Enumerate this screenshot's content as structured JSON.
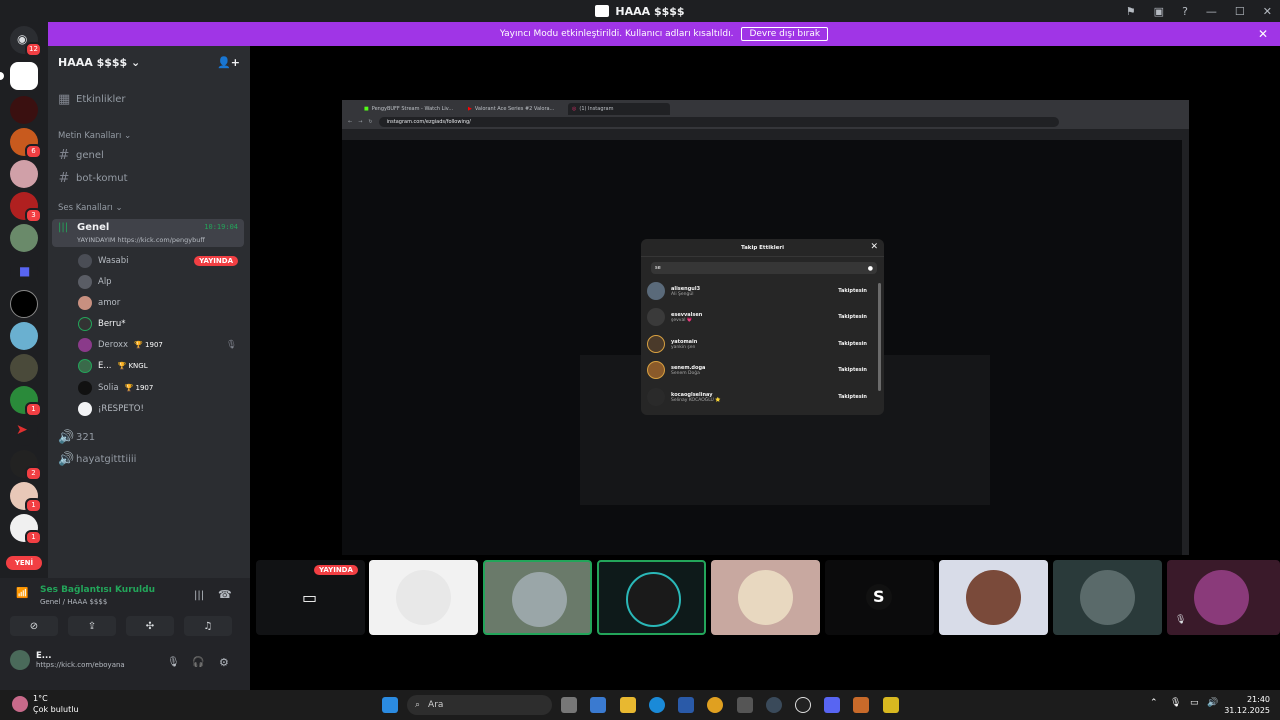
{
  "window": {
    "title": "HAAA $$$$"
  },
  "banner": {
    "text": "Yayıncı Modu etkinleştirildi. Kullanıcı adları kısaltıldı.",
    "button": "Devre dışı bırak"
  },
  "guild_badges": [
    "12",
    "6",
    "3",
    "1",
    "2",
    "1",
    "1",
    "1",
    "YENİ"
  ],
  "server": {
    "name": "HAAA $$$$",
    "events": "Etkinlikler",
    "text_category": "Metin Kanalları",
    "text_channels": [
      "genel",
      "bot-komut"
    ],
    "voice_category": "Ses Kanalları",
    "active_voice": {
      "name": "Genel",
      "timer": "10:19:04",
      "status": "YAYINDAYIM https://kick.com/pengybuff"
    },
    "voice_users": [
      {
        "name": "Wasabi",
        "tag": "",
        "live": "YAYINDA"
      },
      {
        "name": "Alp",
        "tag": "",
        "live": ""
      },
      {
        "name": "amor",
        "tag": "",
        "live": ""
      },
      {
        "name": "Berru*",
        "tag": "",
        "live": ""
      },
      {
        "name": "Deroxx",
        "tag": "1907",
        "live": ""
      },
      {
        "name": "E...",
        "tag": "KNGL",
        "live": ""
      },
      {
        "name": "Solia",
        "tag": "1907",
        "live": ""
      },
      {
        "name": "¡RESPETO!",
        "tag": "",
        "live": ""
      }
    ],
    "other_voice": [
      "321",
      "hayatgitttiiii"
    ]
  },
  "voice_status": {
    "title": "Ses Bağlantısı Kuruldu",
    "sub": "Genel / HAAA $$$$"
  },
  "me": {
    "name": "E...",
    "status": "https://kick.com/eboyana"
  },
  "browser": {
    "tabs": [
      "PengyBUFF Stream - Watch Liv...",
      "Valorant Ace Series #2 Valora...",
      "(1) Instagram"
    ],
    "url": "instagram.com/ezgiads/following/"
  },
  "modal": {
    "title": "Takip Ettikleri",
    "search_value": "se",
    "rows": [
      {
        "user": "alisengul3",
        "name": "Ali Şengül",
        "button": "Takiptesin"
      },
      {
        "user": "esevvalsen",
        "name": "şevval 💗",
        "button": "Takiptesin"
      },
      {
        "user": "yatomain",
        "name": "yankin şen",
        "button": "Takiptesin"
      },
      {
        "user": "senem.doga",
        "name": "Senem Doğa",
        "button": "Takiptesin"
      },
      {
        "user": "kocaoglselinay",
        "name": "Selinay KOCAOĞLU ⭐",
        "button": "Takiptesin"
      }
    ]
  },
  "tiles": {
    "live_label": "YAYINDA"
  },
  "taskbar": {
    "search": "Ara",
    "weather_temp": "1°C",
    "weather_desc": "Çok bulutlu",
    "time": "21:40",
    "date": "31.12.2025"
  },
  "colors": {
    "brand": "#5865f2",
    "live": "#f23f43",
    "banner": "#a035e6",
    "online": "#23a55a"
  }
}
